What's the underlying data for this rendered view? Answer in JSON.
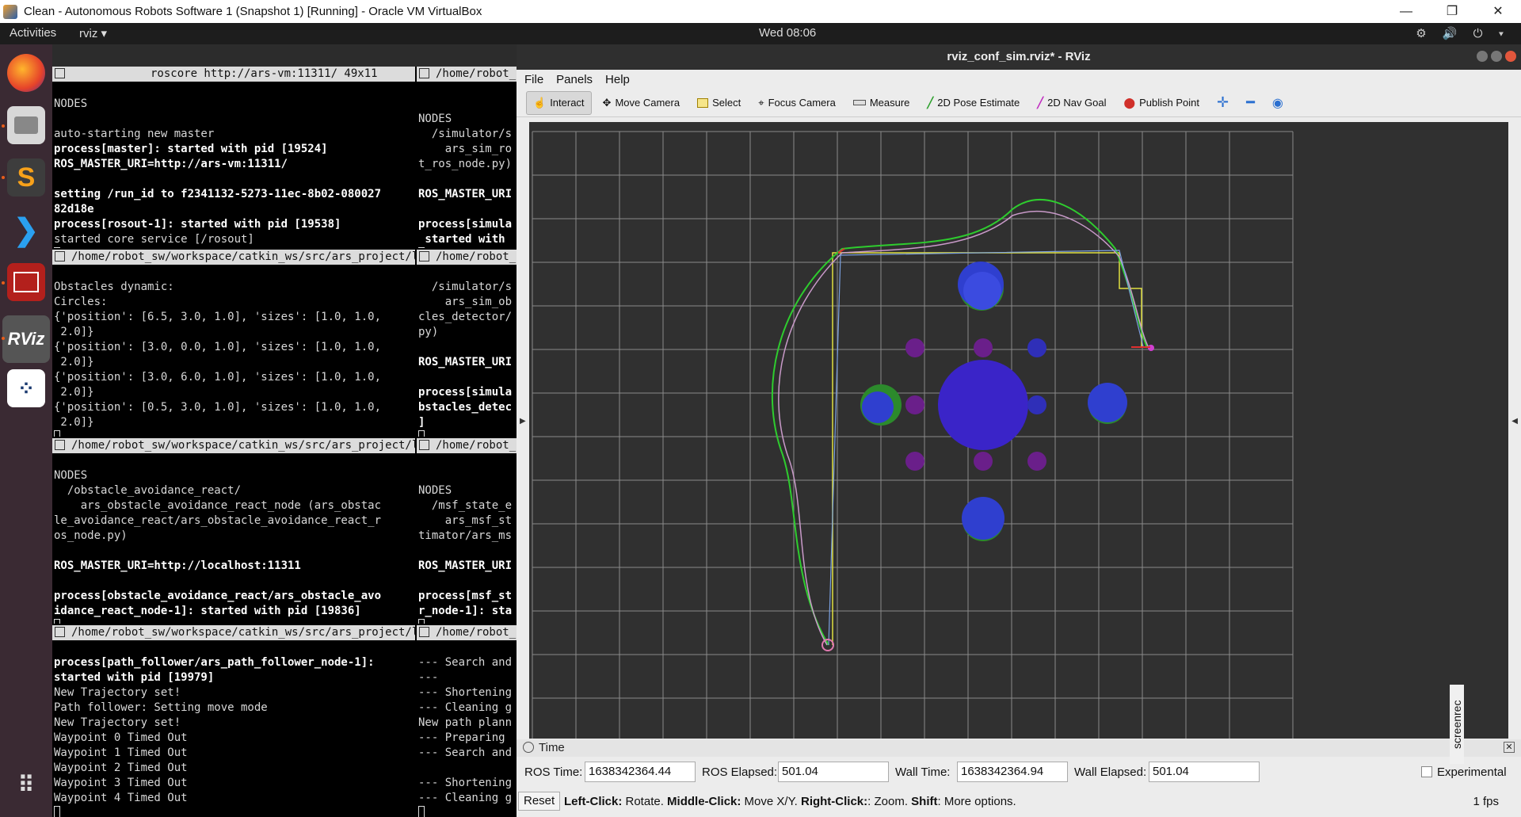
{
  "vbox": {
    "title": "Clean - Autonomous Robots Software 1 (Snapshot 1) [Running] - Oracle VM VirtualBox",
    "min": "—",
    "restore": "❐",
    "close": "✕"
  },
  "topbar": {
    "activities": "Activities",
    "app_menu": "rviz ▾",
    "clock": "Wed 08:06",
    "tray_icons": "⚙ 🔊 ⏻ ▾"
  },
  "dock": {
    "apps": [
      "Firefox",
      "Files",
      "Sublime Text",
      "VS Code",
      "Terminator",
      "RViz",
      "Apps",
      "Show Applications"
    ]
  },
  "terminals": {
    "t1": {
      "title": "roscore http://ars-vm:11311/ 49x11",
      "lines": [
        "NODES",
        "",
        "auto-starting new master",
        "process[master]: started with pid [19524]",
        "ROS_MASTER_URI=http://ars-vm:11311/",
        "",
        "setting /run_id to f2341132-5273-11ec-8b02-080027",
        "82d18e",
        "process[rosout-1]: started with pid [19538]",
        "started core service [/rosout]"
      ]
    },
    "t2": {
      "title": "/home/robot_",
      "lines": [
        "",
        "NODES",
        "  /simulator/s",
        "    ars_sim_ro",
        "t_ros_node.py)",
        "",
        "ROS_MASTER_URI",
        "",
        "process[simula",
        " started with"
      ]
    },
    "t3": {
      "title": "/home/robot_sw/workspace/catkin_ws/src/ars_project/launche",
      "lines": [
        "Obstacles dynamic:",
        "Circles:",
        "{'position': [6.5, 3.0, 1.0], 'sizes': [1.0, 1.0,",
        " 2.0]}",
        "{'position': [3.0, 0.0, 1.0], 'sizes': [1.0, 1.0,",
        " 2.0]}",
        "{'position': [3.0, 6.0, 1.0], 'sizes': [1.0, 1.0,",
        " 2.0]}",
        "{'position': [0.5, 3.0, 1.0], 'sizes': [1.0, 1.0,",
        " 2.0]}"
      ]
    },
    "t4": {
      "title": "/home/robot_",
      "lines": [
        "  /simulator/s",
        "    ars_sim_ob",
        "cles_detector/",
        "py)",
        "",
        "ROS_MASTER_URI",
        "",
        "process[simula",
        "bstacles_detec",
        "]"
      ]
    },
    "t5": {
      "title": "/home/robot_sw/workspace/catkin_ws/src/ars_project/launche",
      "lines": [
        "NODES",
        "  /obstacle_avoidance_react/",
        "    ars_obstacle_avoidance_react_node (ars_obstac",
        "le_avoidance_react/ars_obstacle_avoidance_react_r",
        "os_node.py)",
        "",
        "ROS_MASTER_URI=http://localhost:11311",
        "",
        "process[obstacle_avoidance_react/ars_obstacle_avo",
        "idance_react_node-1]: started with pid [19836]"
      ]
    },
    "t6": {
      "title": "/home/robot_",
      "lines": [
        "",
        "NODES",
        "  /msf_state_e",
        "    ars_msf_st",
        "timator/ars_ms",
        "",
        "ROS_MASTER_URI",
        "",
        "process[msf_st",
        "r_node-1]: sta"
      ]
    },
    "t7": {
      "title": "/home/robot_sw/workspace/catkin_ws/src/ars_project/launche",
      "lines": [
        "process[path_follower/ars_path_follower_node-1]:",
        "started with pid [19979]",
        "New Trajectory set!",
        "Path follower: Setting move mode",
        "New Trajectory set!",
        "Waypoint 0 Timed Out",
        "Waypoint 1 Timed Out",
        "Waypoint 2 Timed Out",
        "Waypoint 3 Timed Out",
        "Waypoint 4 Timed Out"
      ]
    },
    "t8": {
      "title": "/home/robot_",
      "lines": [
        "--- Search and",
        "---",
        "--- Shortening",
        "--- Cleaning g",
        "New path plann",
        "--- Preparing",
        "--- Search and",
        "",
        "--- Shortening",
        "--- Cleaning g"
      ]
    }
  },
  "rviz": {
    "title": "rviz_conf_sim.rviz* - RViz",
    "menu": {
      "file": "File",
      "panels": "Panels",
      "help": "Help"
    },
    "tools": {
      "interact": "Interact",
      "move_camera": "Move Camera",
      "select": "Select",
      "focus_camera": "Focus Camera",
      "measure": "Measure",
      "pose_estimate": "2D Pose Estimate",
      "nav_goal": "2D Nav Goal",
      "publish_point": "Publish Point"
    },
    "time_panel": {
      "title": "Time",
      "ros_time_label": "ROS Time:",
      "ros_time": "1638342364.44",
      "ros_elapsed_label": "ROS Elapsed:",
      "ros_elapsed": "501.04",
      "wall_time_label": "Wall Time:",
      "wall_time": "1638342364.94",
      "wall_elapsed_label": "Wall Elapsed:",
      "wall_elapsed": "501.04",
      "experimental": "Experimental"
    },
    "status": {
      "reset": "Reset",
      "left_click": "Left-Click:",
      "left_desc": " Rotate. ",
      "middle_click": "Middle-Click:",
      "middle_desc": " Move X/Y. ",
      "right_click": "Right-Click:",
      "right_desc": ": Zoom. ",
      "shift": "Shift",
      "shift_desc": ": More options.",
      "fps": "1 fps"
    }
  },
  "overlay": {
    "screenrec": "screenrec"
  }
}
